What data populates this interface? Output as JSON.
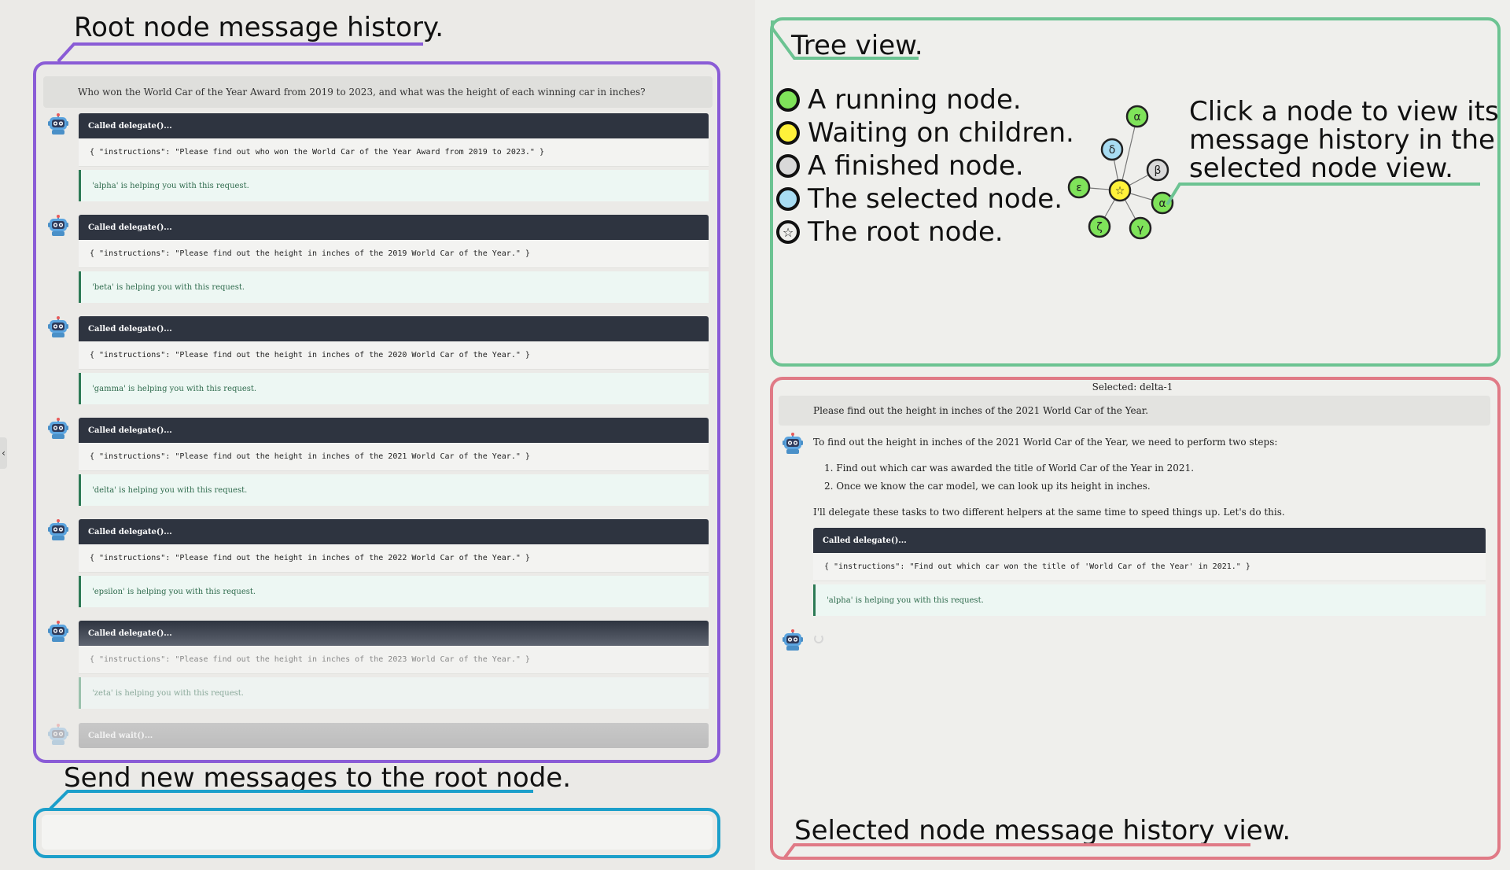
{
  "annotations": {
    "root_history": "Root node message history.",
    "send_new": "Send new messages to the root node.",
    "tree_view": "Tree view.",
    "click_node": [
      "Click a node to view its",
      "message history in the",
      "selected node view."
    ],
    "selected_view": "Selected node message history view."
  },
  "colors": {
    "purple": "#8a5cd6",
    "blue": "#1c9fca",
    "green": "#6cc392",
    "red": "#e07a86",
    "node_running": "#7fe35a",
    "node_waiting": "#fff23a",
    "node_finished": "#d9d9d9",
    "node_selected": "#a8dcf2"
  },
  "collapse_icon": "‹",
  "root_chat": {
    "user_message": "Who won the World Car of the Year Award from 2019 to 2023, and what was the height of each winning car in inches?",
    "calls": [
      {
        "head": "Called delegate()...",
        "args": "{ \"instructions\": \"Please find out who won the World Car of the Year Award from 2019 to 2023.\" }",
        "result": "'alpha' is helping you with this request."
      },
      {
        "head": "Called delegate()...",
        "args": "{ \"instructions\": \"Please find out the height in inches of the 2019 World Car of the Year.\" }",
        "result": "'beta' is helping you with this request."
      },
      {
        "head": "Called delegate()...",
        "args": "{ \"instructions\": \"Please find out the height in inches of the 2020 World Car of the Year.\" }",
        "result": "'gamma' is helping you with this request."
      },
      {
        "head": "Called delegate()...",
        "args": "{ \"instructions\": \"Please find out the height in inches of the 2021 World Car of the Year.\" }",
        "result": "'delta' is helping you with this request."
      },
      {
        "head": "Called delegate()...",
        "args": "{ \"instructions\": \"Please find out the height in inches of the 2022 World Car of the Year.\" }",
        "result": "'epsilon' is helping you with this request."
      },
      {
        "head": "Called delegate()...",
        "args": "{ \"instructions\": \"Please find out the height in inches of the 2023 World Car of the Year.\" }",
        "result": "'zeta' is helping you with this request."
      }
    ],
    "wait": "Called wait()..."
  },
  "legend": [
    {
      "label": "A running node.",
      "state": "running"
    },
    {
      "label": "Waiting on children.",
      "state": "waiting"
    },
    {
      "label": "A finished node.",
      "state": "finished"
    },
    {
      "label": "The selected node.",
      "state": "selected"
    },
    {
      "label": "The root node.",
      "state": "root",
      "icon": "☆"
    }
  ],
  "tree": {
    "root": {
      "label": "☆",
      "state": "waiting"
    },
    "nodes": [
      {
        "label": "α",
        "state": "running"
      },
      {
        "label": "δ",
        "state": "selected"
      },
      {
        "label": "β",
        "state": "finished"
      },
      {
        "label": "ε",
        "state": "running"
      },
      {
        "label": "α",
        "state": "running"
      },
      {
        "label": "ζ",
        "state": "running"
      },
      {
        "label": "γ",
        "state": "running"
      }
    ]
  },
  "selected": {
    "title": "Selected: delta-1",
    "user_message": "Please find out the height in inches of the 2021 World Car of the Year.",
    "intro": "To find out the height in inches of the 2021 World Car of the Year, we need to perform two steps:",
    "steps": [
      "1. Find out which car was awarded the title of World Car of the Year in 2021.",
      "2. Once we know the car model, we can look up its height in inches."
    ],
    "outro": "I'll delegate these tasks to two different helpers at the same time to speed things up. Let's do this.",
    "call": {
      "head": "Called delegate()...",
      "args": "{ \"instructions\": \"Find out which car won the title of 'World Car of the Year' in 2021.\" }",
      "result": "'alpha' is helping you with this request."
    }
  }
}
